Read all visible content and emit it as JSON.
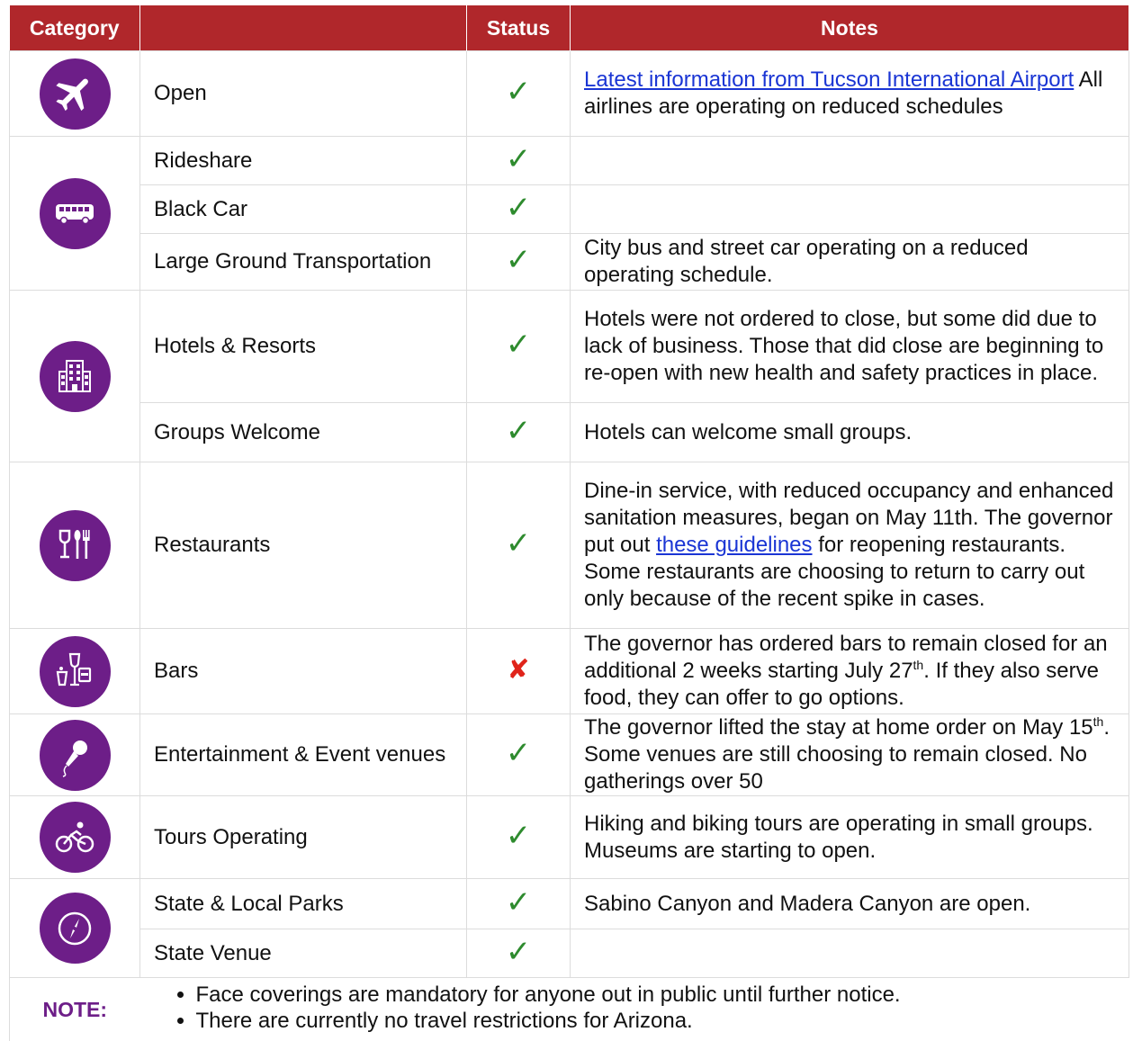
{
  "header": {
    "category": "Category",
    "status": "Status",
    "notes": "Notes"
  },
  "rows": {
    "airport": {
      "name": "Open",
      "notes_link": "Latest information from Tucson International Airport",
      "notes_text": " All airlines are operating on reduced schedules"
    },
    "rideshare": {
      "name": "Rideshare",
      "notes": ""
    },
    "black_car": {
      "name": "Black Car",
      "notes": ""
    },
    "large_ground": {
      "name": "Large Ground Transportation",
      "notes": "City bus and street car operating on a reduced operating schedule."
    },
    "hotels": {
      "name": "Hotels & Resorts",
      "notes": "Hotels were not ordered to close, but some did due to lack of business.  Those that did close are beginning to re-open with new health and safety practices in place."
    },
    "groups": {
      "name": "Groups Welcome",
      "notes": "Hotels can welcome small groups."
    },
    "restaurants": {
      "name": "Restaurants",
      "notes_before": "Dine-in service, with reduced occupancy and enhanced sanitation measures, began on May 11th. The governor put out ",
      "notes_link": "these guidelines",
      "notes_after": " for reopening restaurants. Some restaurants are choosing to return to carry out only because of the recent spike in cases."
    },
    "bars": {
      "name": "Bars",
      "notes_before": "The governor has ordered bars to remain closed for an additional 2 weeks starting July 27",
      "notes_sup": "th",
      "notes_after": ". If they also serve food, they can offer to go options."
    },
    "entertainment": {
      "name": "Entertainment & Event venues",
      "notes_before": "The governor lifted the stay at home order on May 15",
      "notes_sup": "th",
      "notes_after": ". Some venues are still choosing to remain closed. No gatherings over 50"
    },
    "tours": {
      "name": "Tours Operating",
      "notes": "Hiking and biking tours are operating in small groups. Museums are starting to open."
    },
    "parks": {
      "name": "State & Local Parks",
      "notes": "Sabino Canyon and Madera Canyon are open."
    },
    "state_venue": {
      "name": "State Venue",
      "notes": ""
    }
  },
  "status": {
    "open": "✓",
    "closed": "✘"
  },
  "note": {
    "label": "NOTE:",
    "items": [
      "Face coverings are mandatory for anyone out in public until further notice.",
      "There are currently no travel restrictions for Arizona."
    ]
  },
  "colors": {
    "header_bg": "#b0272b",
    "icon_bg": "#6d1e88",
    "check": "#2e8b2e",
    "cross": "#e0241a",
    "link": "#1a35d4"
  },
  "icons": [
    "airplane-icon",
    "bus-icon",
    "building-icon",
    "dining-icon",
    "drinks-icon",
    "microphone-icon",
    "bicycle-icon",
    "compass-icon"
  ]
}
